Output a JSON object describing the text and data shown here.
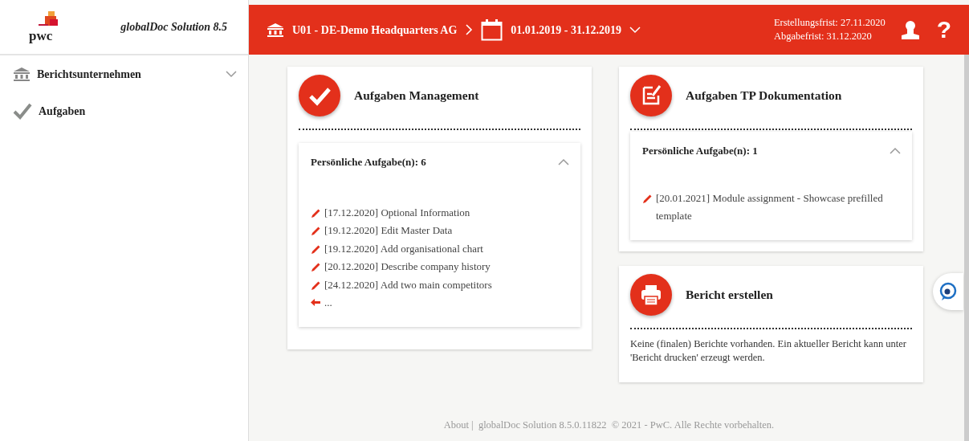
{
  "sidebar": {
    "logo_text": "pwc",
    "product": "globalDoc Solution 8.5",
    "items": [
      {
        "kind": "group",
        "label": "Berichtsunternehmen",
        "expanded": false
      },
      {
        "kind": "link",
        "label": "Aufgaben"
      }
    ]
  },
  "header": {
    "company": "U01 - DE-Demo Headquarters AG",
    "period": "01.01.2019 - 31.12.2019",
    "deadlines": [
      "Erstellungsfrist: 27.11.2020",
      "Abgabefrist: 31.12.2020"
    ],
    "help": "?"
  },
  "cards": [
    {
      "kind": "tasks",
      "title": "Aufgaben Management",
      "panel": {
        "heading": "Persönliche Aufgabe(n): 6",
        "expanded": true,
        "items": [
          {
            "kind": "task",
            "text": "[17.12.2020] Optional Information"
          },
          {
            "kind": "task",
            "text": "[19.12.2020] Edit Master Data"
          },
          {
            "kind": "task",
            "text": "[19.12.2020] Add organisational chart"
          },
          {
            "kind": "task",
            "text": "[20.12.2020] Describe company history"
          },
          {
            "kind": "task",
            "text": "[24.12.2020] Add two main competitors"
          },
          {
            "kind": "more",
            "text": "..."
          }
        ]
      }
    },
    {
      "kind": "tasks",
      "title": "Aufgaben TP Dokumentation",
      "panel": {
        "heading": "Persönliche Aufgabe(n): 1",
        "expanded": true,
        "items": [
          {
            "kind": "task",
            "text": "[20.01.2021] Module assignment - Showcase prefilled template"
          }
        ]
      }
    },
    {
      "kind": "report",
      "title": "Bericht erstellen",
      "message": "Keine (finalen) Berichte vorhanden. Ein aktueller Bericht kann unter 'Bericht drucken' erzeugt werden."
    }
  ],
  "footer": {
    "link": "About",
    "separator": "|",
    "text": "globalDoc Solution 8.5.0.11822  © 2021 - PwC. Alle Rechte vorbehalten."
  }
}
